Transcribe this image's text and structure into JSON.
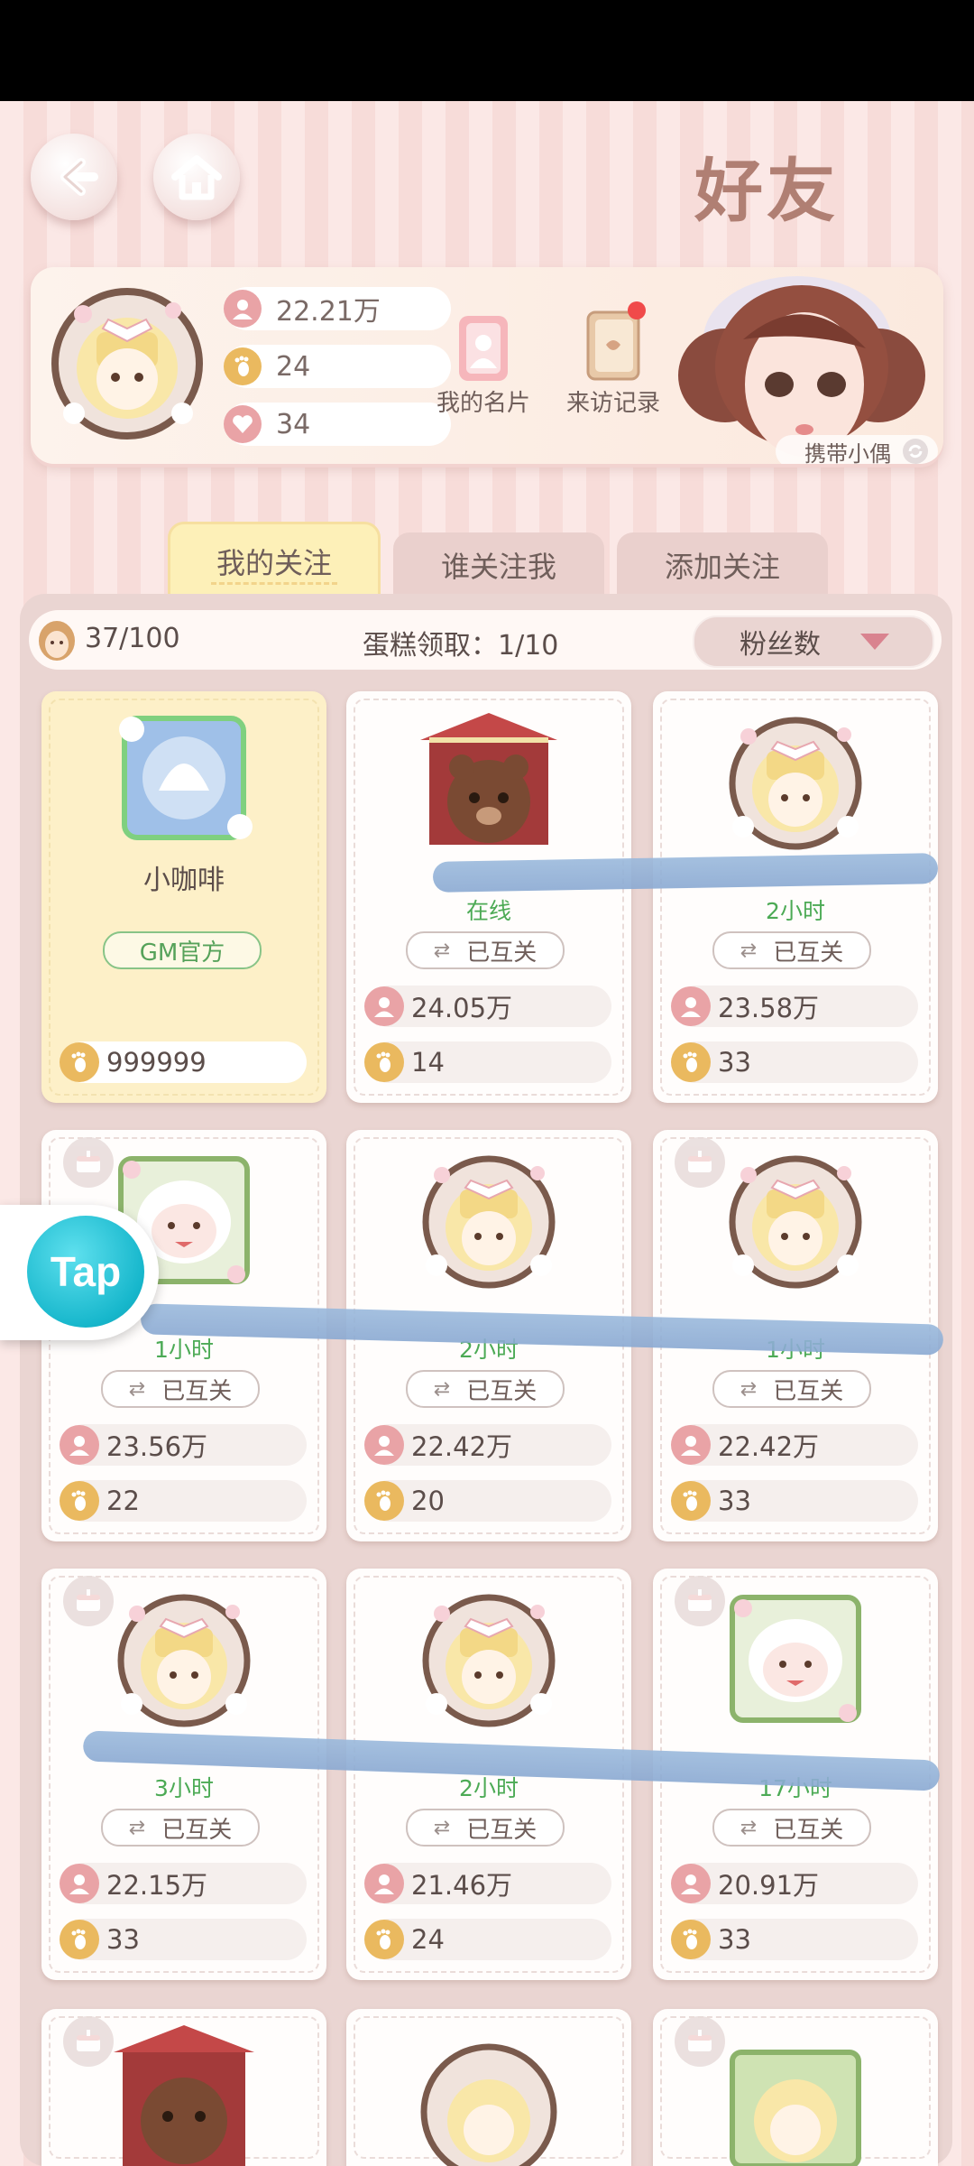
{
  "header": {
    "title": "好友",
    "back_icon": "back-arrow-icon",
    "home_icon": "home-icon"
  },
  "profile": {
    "popularity": "22.21万",
    "footprints": "24",
    "hearts": "34",
    "card_label": "我的名片",
    "visitors_label": "来访记录",
    "carry_doll_label": "携带小偶"
  },
  "tabs": [
    {
      "label": "我的关注",
      "active": true
    },
    {
      "label": "谁关注我",
      "active": false
    },
    {
      "label": "添加关注",
      "active": false
    }
  ],
  "filter": {
    "count": "37/100",
    "cake_label": "蛋糕领取：1/10",
    "sort_label": "粉丝数"
  },
  "cards": [
    {
      "name": "小咖啡",
      "badge": "GM官方",
      "popularity": "",
      "footprints": "999999",
      "kind": "gm"
    },
    {
      "status": "在线",
      "mutual": "已互关",
      "popularity": "24.05万",
      "footprints": "14",
      "kind": "bear"
    },
    {
      "status": "2小时",
      "mutual": "已互关",
      "popularity": "23.58万",
      "footprints": "33",
      "kind": "doll"
    },
    {
      "status": "1小时",
      "mutual": "已互关",
      "popularity": "23.56万",
      "footprints": "22",
      "kind": "sheep"
    },
    {
      "status": "2小时",
      "mutual": "已互关",
      "popularity": "22.42万",
      "footprints": "20",
      "kind": "doll"
    },
    {
      "status": "1小时",
      "mutual": "已互关",
      "popularity": "22.42万",
      "footprints": "33",
      "kind": "doll"
    },
    {
      "status": "3小时",
      "mutual": "已互关",
      "popularity": "22.15万",
      "footprints": "33",
      "kind": "doll"
    },
    {
      "status": "2小时",
      "mutual": "已互关",
      "popularity": "21.46万",
      "footprints": "24",
      "kind": "doll"
    },
    {
      "status": "17小时",
      "mutual": "已互关",
      "popularity": "20.91万",
      "footprints": "33",
      "kind": "sheep"
    }
  ],
  "floating": {
    "tap_label": "Tap"
  },
  "colors": {
    "accent_green": "#4caa55",
    "title_brown": "#b07f73",
    "tab_active": "#fdf0b8"
  }
}
